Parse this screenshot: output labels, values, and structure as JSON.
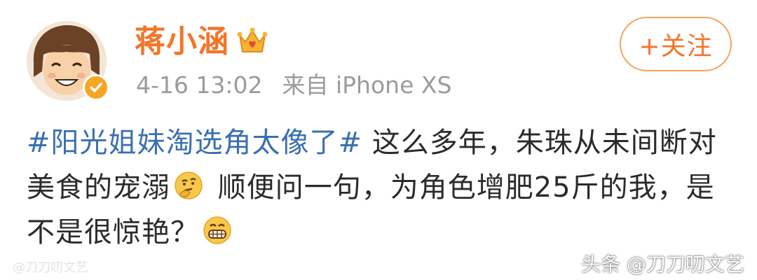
{
  "user": {
    "name": "蒋小涵",
    "badge_icon": "crown-icon",
    "verified_icon": "verified-check-icon"
  },
  "meta": {
    "time": "4-16 13:02",
    "source": "来自 iPhone XS"
  },
  "follow_button": {
    "label": "+关注"
  },
  "post": {
    "hashtag": "#阳光姐妹淘选角太像了#",
    "text_1": " 这么多年，朱珠从未间断对美食的宠溺",
    "emoji_1": "thinking-face-emoji",
    "text_2": " 顺便问一句，为角色增肥25斤的我，是不是很惊艳？",
    "emoji_2": "grinning-face-emoji"
  },
  "watermarks": {
    "left": "@刀刀叨文艺",
    "right": "头条 @刀刀叨文艺"
  },
  "colors": {
    "accent_orange": "#f2762a",
    "hashtag_blue": "#3a6fb0",
    "meta_gray": "#9b9b9b",
    "verified_gold": "#f6a623"
  }
}
